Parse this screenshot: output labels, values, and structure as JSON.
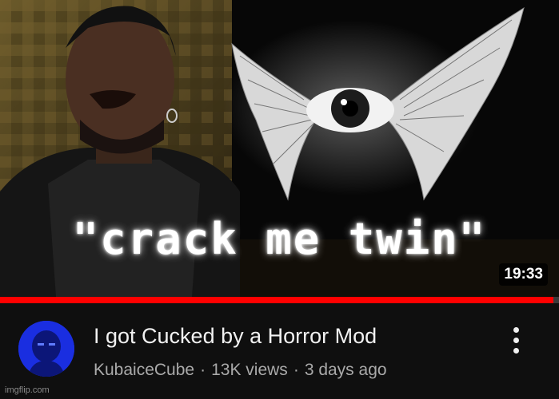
{
  "thumbnail": {
    "caption": "\"crack me twin\"",
    "duration": "19:33"
  },
  "progress": {
    "fraction": 0.99,
    "color": "#ff0000"
  },
  "video": {
    "title": "I got Cucked by a Horror Mod",
    "channel": "KubaiceCube",
    "views": "13K views",
    "age": "3 days ago",
    "separator": "·"
  },
  "icons": {
    "more": "more-vert-icon",
    "avatar": "channel-avatar"
  },
  "watermark": "imgflip.com",
  "colors": {
    "background": "#0f0f0f",
    "title": "#f1f1f1",
    "subtext": "#aaaaaa",
    "accent": "#ff0000"
  }
}
